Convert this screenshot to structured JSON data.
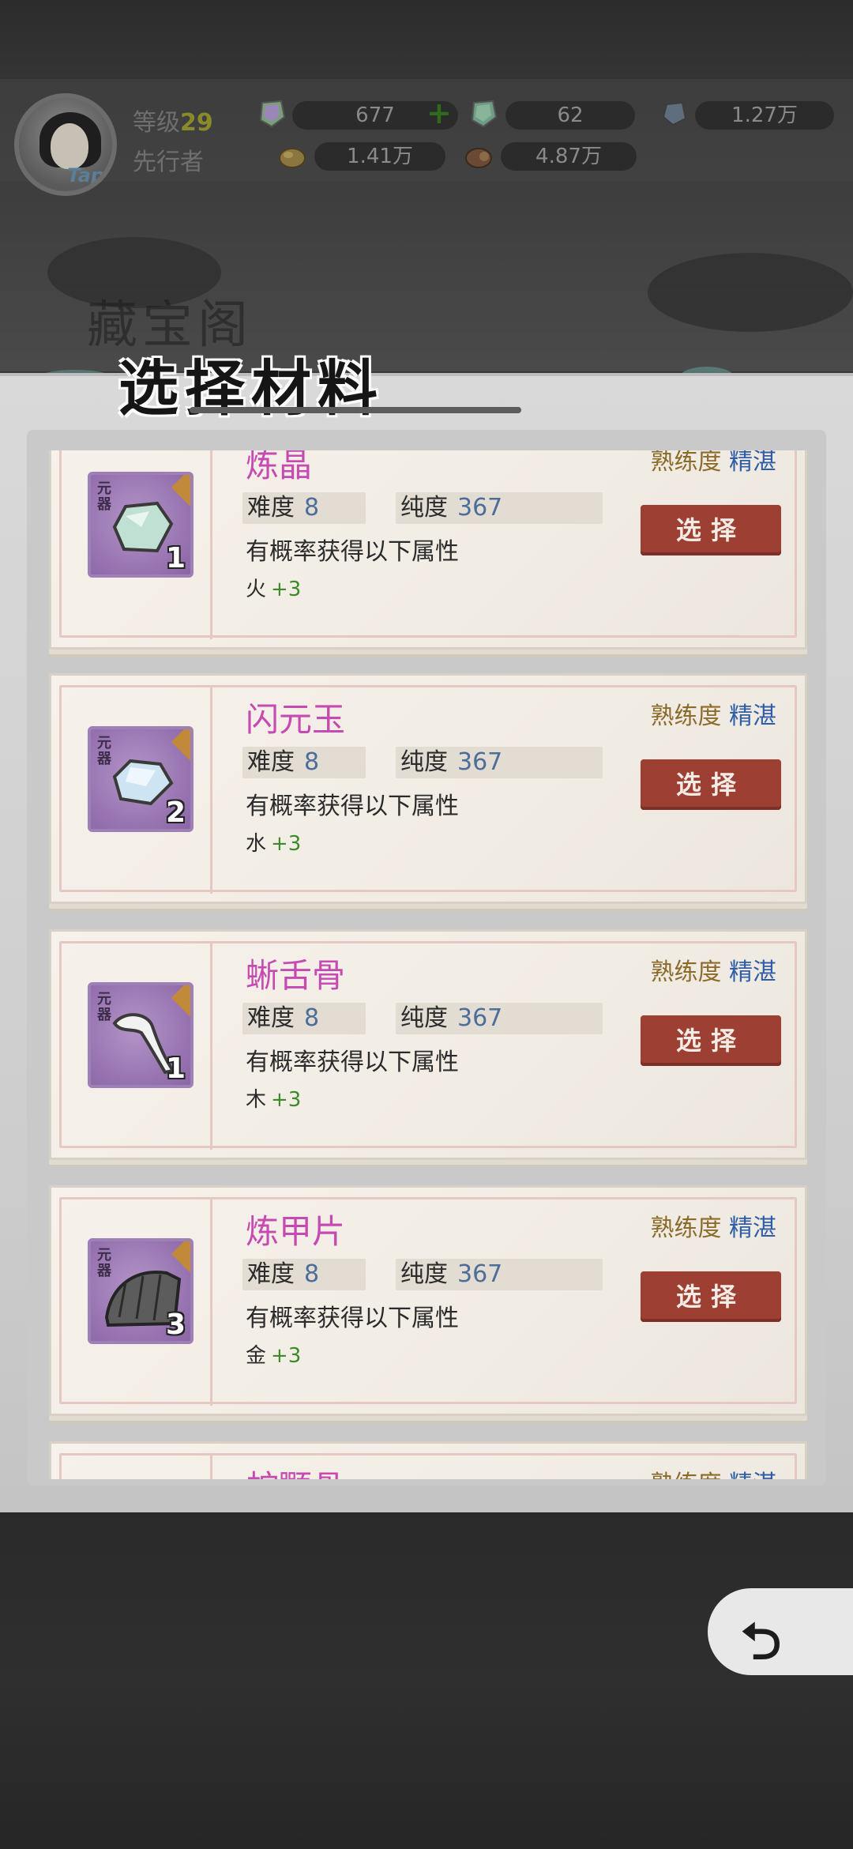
{
  "player": {
    "level_label": "等级",
    "level": "29",
    "name": "先行者",
    "avatar_badge": "Tap"
  },
  "resources": [
    {
      "name": "spirit-stone",
      "value": "677"
    },
    {
      "name": "jade-crystal",
      "value": "62"
    },
    {
      "name": "blue-gem",
      "value": "1.27万"
    },
    {
      "name": "gold-ore",
      "value": "1.41万"
    },
    {
      "name": "wood-log",
      "value": "4.87万"
    }
  ],
  "header": {
    "bg_title": "藏宝阁",
    "title": "选择材料"
  },
  "materials": [
    {
      "name": "炼晶",
      "difficulty_label": "难度",
      "difficulty": "8",
      "purity_label": "纯度",
      "purity": "367",
      "prof_label": "熟练度",
      "prof_value": "精湛",
      "desc": "有概率获得以下属性",
      "attr": "火",
      "attr_bonus": "+3",
      "count": "1",
      "tag": "元器",
      "select_label": "选择"
    },
    {
      "name": "闪元玉",
      "difficulty_label": "难度",
      "difficulty": "8",
      "purity_label": "纯度",
      "purity": "367",
      "prof_label": "熟练度",
      "prof_value": "精湛",
      "desc": "有概率获得以下属性",
      "attr": "水",
      "attr_bonus": "+3",
      "count": "2",
      "tag": "元器",
      "select_label": "选择"
    },
    {
      "name": "蜥舌骨",
      "difficulty_label": "难度",
      "difficulty": "8",
      "purity_label": "纯度",
      "purity": "367",
      "prof_label": "熟练度",
      "prof_value": "精湛",
      "desc": "有概率获得以下属性",
      "attr": "木",
      "attr_bonus": "+3",
      "count": "1",
      "tag": "元器",
      "select_label": "选择"
    },
    {
      "name": "炼甲片",
      "difficulty_label": "难度",
      "difficulty": "8",
      "purity_label": "纯度",
      "purity": "367",
      "prof_label": "熟练度",
      "prof_value": "精湛",
      "desc": "有概率获得以下属性",
      "attr": "金",
      "attr_bonus": "+3",
      "count": "3",
      "tag": "元器",
      "select_label": "选择"
    },
    {
      "name": "蛇颚骨",
      "prof_label": "熟练度",
      "prof_value": "精湛"
    }
  ],
  "colors": {
    "rarity_name": "#c54bb3",
    "select_button": "#9e3f34",
    "bonus": "#3d8a29"
  }
}
